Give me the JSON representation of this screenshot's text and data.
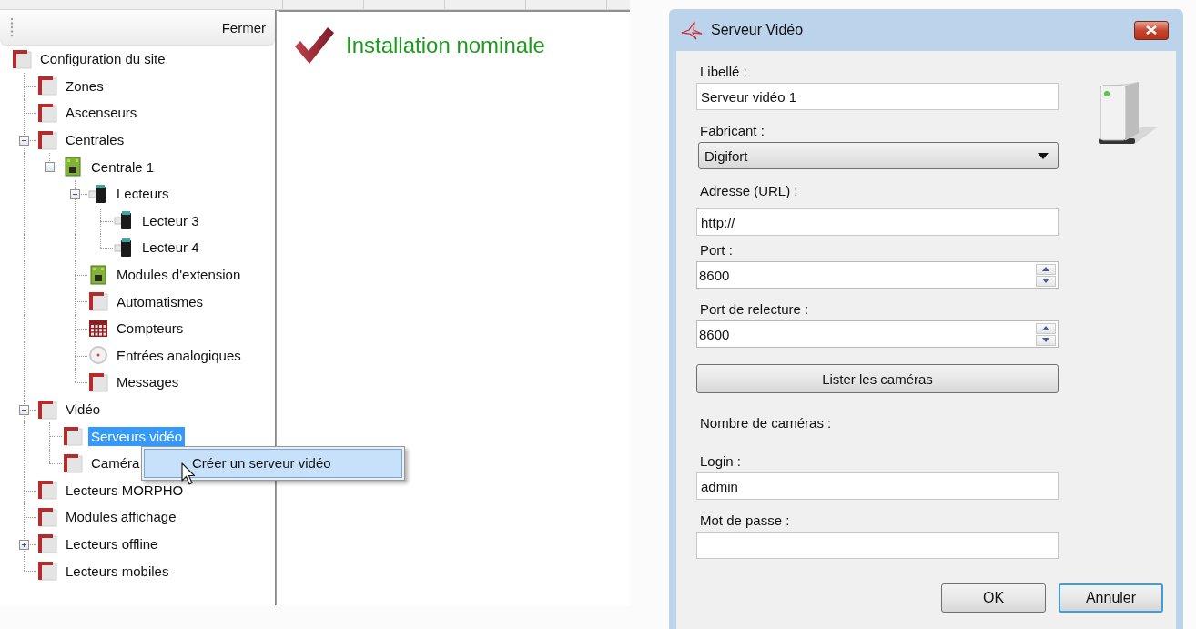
{
  "tree_panel": {
    "close_label": "Fermer",
    "items": [
      {
        "label": "Configuration du site",
        "kind": "flag",
        "selected": false,
        "children": [
          {
            "label": "Zones",
            "kind": "flag",
            "selected": false
          },
          {
            "label": "Ascenseurs",
            "kind": "flag",
            "selected": false
          },
          {
            "label": "Centrales",
            "kind": "flag",
            "selected": false,
            "expanded": true,
            "children": [
              {
                "label": "Centrale 1",
                "kind": "board",
                "selected": false,
                "expanded": true,
                "children": [
                  {
                    "label": "Lecteurs",
                    "kind": "reader",
                    "selected": false,
                    "expanded": true,
                    "children": [
                      {
                        "label": "Lecteur 3",
                        "kind": "reader",
                        "selected": false
                      },
                      {
                        "label": "Lecteur 4",
                        "kind": "reader",
                        "selected": false
                      }
                    ]
                  },
                  {
                    "label": "Modules d'extension",
                    "kind": "board",
                    "selected": false
                  },
                  {
                    "label": "Automatismes",
                    "kind": "flag",
                    "selected": false
                  },
                  {
                    "label": "Compteurs",
                    "kind": "grid",
                    "selected": false
                  },
                  {
                    "label": "Entrées analogiques",
                    "kind": "gauge",
                    "selected": false
                  },
                  {
                    "label": "Messages",
                    "kind": "flag",
                    "selected": false
                  }
                ]
              }
            ]
          },
          {
            "label": "Vidéo",
            "kind": "flag",
            "selected": false,
            "expanded": true,
            "children": [
              {
                "label": "Serveurs vidéo",
                "kind": "flag",
                "selected": true
              },
              {
                "label": "Caméra",
                "kind": "flag",
                "selected": false
              }
            ]
          },
          {
            "label": "Lecteurs MORPHO",
            "kind": "flag",
            "selected": false
          },
          {
            "label": "Modules affichage",
            "kind": "flag",
            "selected": false
          },
          {
            "label": "Lecteurs offline",
            "kind": "flag",
            "selected": false,
            "expanded": false
          },
          {
            "label": "Lecteurs mobiles",
            "kind": "flag",
            "selected": false
          }
        ]
      }
    ]
  },
  "context_menu": {
    "items": [
      {
        "label": "Créer un serveur vidéo",
        "selected": true
      }
    ]
  },
  "status": {
    "message": "Installation nominale"
  },
  "dialog": {
    "title": "Serveur Vidéo",
    "fields": [
      {
        "kind": "text",
        "label": "Libellé :",
        "value": "Serveur vidéo 1"
      },
      {
        "kind": "dropdown",
        "label": "Fabricant :",
        "value": "Digifort"
      },
      {
        "kind": "text",
        "label": "Adresse (URL) :",
        "value": "http://"
      },
      {
        "kind": "spin",
        "label": "Port :",
        "value": "8600"
      },
      {
        "kind": "spin",
        "label": "Port de relecture :",
        "value": "8600"
      },
      {
        "kind": "button",
        "label": "Lister les caméras"
      },
      {
        "kind": "info",
        "label": "Nombre de caméras :"
      },
      {
        "kind": "text",
        "label": "Login :",
        "value": "admin"
      },
      {
        "kind": "text",
        "label": "Mot de passe :"
      }
    ],
    "buttons": [
      {
        "label": "OK",
        "focused": false
      },
      {
        "label": "Annuler",
        "focused": true
      }
    ]
  }
}
